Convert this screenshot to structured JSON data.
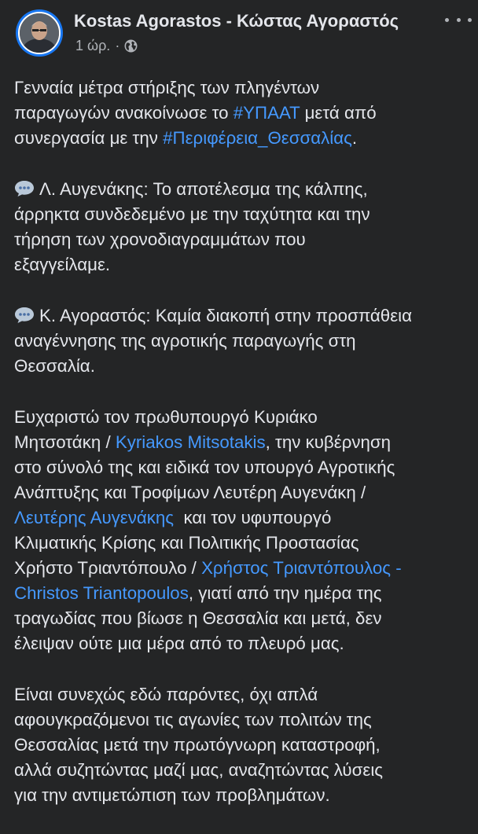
{
  "author": {
    "name": "Kostas Agorastos - Κώστας Αγοραστός",
    "time": "1 ώρ.",
    "separator": "·",
    "audience_icon": "globe-icon"
  },
  "header": {
    "more_icon": "more-options-icon"
  },
  "post": {
    "p1": {
      "l1": "Γενναία μέτρα στήριξης των πληγέντων",
      "l2_pre": "παραγωγών ανακοίνωσε το ",
      "l2_link": "#ΥΠΑΑΤ",
      "l2_post": " μετά από",
      "l3_pre": "συνεργασία με την ",
      "l3_link": "#Περιφέρεια_Θεσσαλίας",
      "l3_post": "."
    },
    "p2": {
      "icon": "speech-bubble-icon",
      "l1": "Λ. Αυγενάκης: Το αποτέλεσμα της κάλπης,",
      "l2": "άρρηκτα συνδεδεμένο με την ταχύτητα και την",
      "l3": "τήρηση των χρονοδιαγραμμάτων που",
      "l4": "εξαγγείλαμε."
    },
    "p3": {
      "icon": "speech-bubble-icon",
      "l1": "Κ. Αγοραστός: Καμία διακοπή στην προσπάθεια",
      "l2": "αναγέννησης της αγροτικής παραγωγής στη",
      "l3": "Θεσσαλία."
    },
    "p4": {
      "l1": "Ευχαριστώ τον πρωθυπουργό Κυριάκο",
      "l2_pre": "Μητσοτάκη / ",
      "l2_link": "Kyriakos Mitsotakis",
      "l2_post": ", την κυβέρνηση",
      "l3": "στο σύνολό της και ειδικά τον υπουργό Αγροτικής",
      "l4": "Ανάπτυξης και Τροφίμων Λευτέρη Αυγενάκη /",
      "l5_link": "Λευτέρης Αυγενάκης",
      "l5_post": "  και τον υφυπουργό",
      "l6": "Κλιματικής Κρίσης και Πολιτικής Προστασίας",
      "l7_pre": "Χρήστο Τριαντόπουλο / ",
      "l7_link": "Χρήστος Τριαντόπουλος -",
      "l8_link": "Christos Triantopoulos",
      "l8_post": ", γιατί από την ημέρα της",
      "l9": "τραγωδίας που βίωσε η Θεσσαλία και μετά, δεν",
      "l10": "έλειψαν ούτε μια μέρα από το πλευρό μας."
    },
    "p5": {
      "l1": "Είναι συνεχώς εδώ παρόντες, όχι απλά",
      "l2": "αφουγκραζόμενοι τις αγωνίες των πολιτών της",
      "l3": "Θεσσαλίας μετά την πρωτόγνωρη καταστροφή,",
      "l4": "αλλά συζητώντας μαζί μας, αναζητώντας λύσεις",
      "l5": "για την αντιμετώπιση των προβλημάτων."
    }
  },
  "colors": {
    "background": "#242526",
    "text": "#e4e6eb",
    "secondary_text": "#b0b3b8",
    "link": "#4599ff",
    "avatar_ring": "#1877f2"
  }
}
